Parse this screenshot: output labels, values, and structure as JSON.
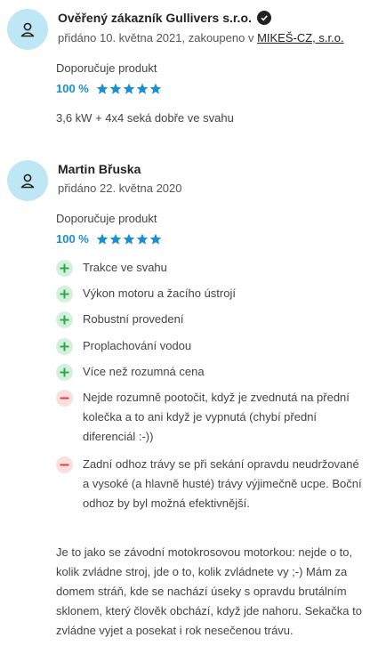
{
  "reviews": [
    {
      "author": "Ověřený zákazník Gullivers s.r.o.",
      "verified": true,
      "meta_prefix": "přidáno 10. května 2021, zakoupeno v ",
      "shop": "MIKEŠ-CZ, s.r.o.",
      "recommend": "Doporučuje produkt",
      "percent": "100 %",
      "stars": 5,
      "text": "3,6 kW + 4x4 seká dobře ve svahu"
    },
    {
      "author": "Martin Břuska",
      "meta": "přidáno 22. května 2020",
      "recommend": "Doporučuje produkt",
      "percent": "100 %",
      "stars": 5,
      "pros": [
        "Trakce ve svahu",
        "Výkon motoru a žacího ústrojí",
        "Robustní provedení",
        "Proplachování vodou",
        "Více než rozumná cena"
      ],
      "cons": [
        "Nejde rozumně pootočit, když je zvednutá na přední kolečka a to ani když je vypnutá (chybí přední diferenciál :-))",
        "Zadní odhoz trávy se při sekání opravdu neudržované a vysoké (a hlavně husté) trávy výjimečně ucpe. Boční odhoz by byl možná efektivnější."
      ],
      "text": "Je to jako se závodní motokrosovou motorkou: nejde o to, kolik zvládne stroj, jde o to, kolik zvládnete vy ;-) Mám za domem stráň, kde se nachází úseky s opravdu brutálním sklonem, který člověk obchází, když jde nahoru. Sekačka to zvládne vyjet a posekat i rok nesečenou trávu."
    }
  ],
  "colors": {
    "accent": "#1a8fd3",
    "star": "#1a8fd3",
    "avatar": "#bfe6f5",
    "pro": "#2faa4a",
    "con": "#d9413f"
  }
}
